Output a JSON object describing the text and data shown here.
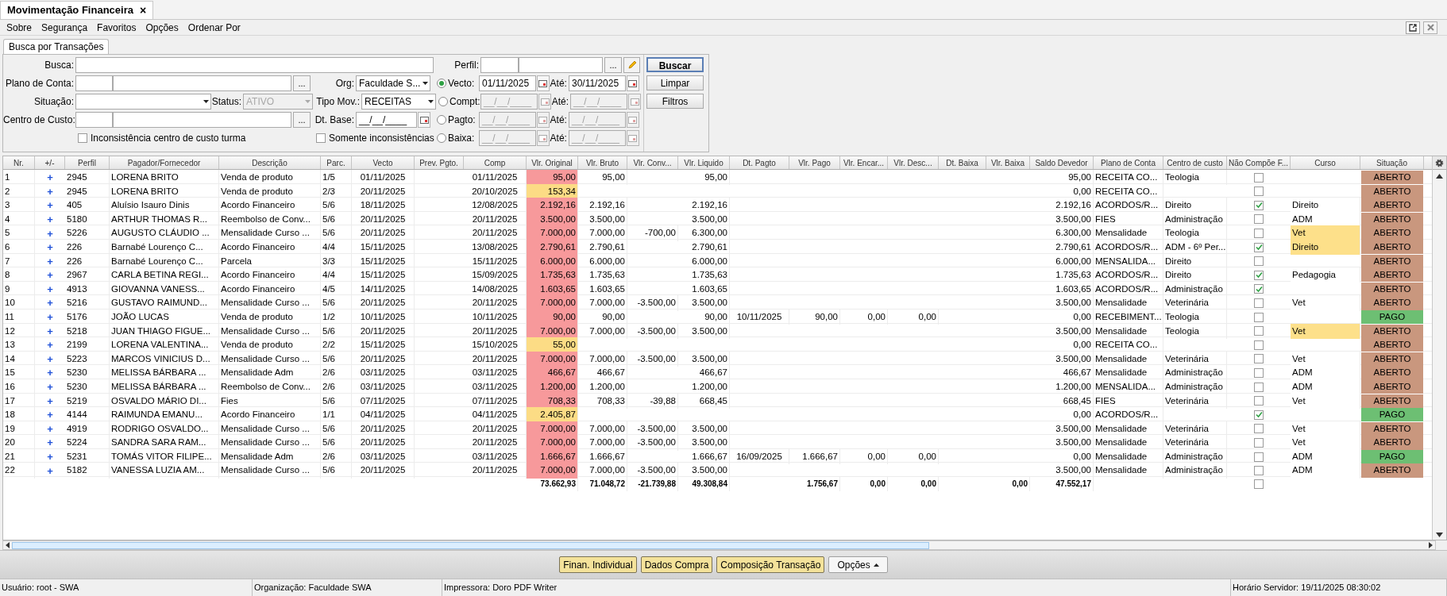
{
  "window": {
    "title": "Movimentação Financeira",
    "close": "×"
  },
  "menu": [
    "Sobre",
    "Segurança",
    "Favoritos",
    "Opções",
    "Ordenar Por"
  ],
  "search_form": {
    "tab": {
      "label": "Busca por Transações",
      "selected": true
    },
    "busca": {
      "label": "Busca:"
    },
    "perfil": {
      "label": "Perfil:",
      "button": "..."
    },
    "plano_de_conta": {
      "label": "Plano de Conta:",
      "button": "..."
    },
    "org": {
      "label": "Org:",
      "value": "Faculdade S..."
    },
    "situacao": {
      "label": "Situação:"
    },
    "status": {
      "label": "Status:",
      "value": "ATIVO",
      "disabled": true
    },
    "tipo_mov": {
      "label": "Tipo Mov.:",
      "value": "RECEITAS"
    },
    "centro_de_custo": {
      "label": "Centro de Custo:",
      "button": "..."
    },
    "dt_base": {
      "label": "Dt. Base:",
      "value": "__/__/____"
    },
    "checkboxes": [
      {
        "label": "Inconsistência centro de custo turma",
        "checked": false
      },
      {
        "label": "Somente inconsistências",
        "checked": false
      }
    ],
    "date_filters": [
      {
        "label": "Vecto:",
        "selected": true,
        "from": "01/11/2025",
        "to_label": "Até:",
        "to": "30/11/2025"
      },
      {
        "label": "Compt:",
        "selected": false,
        "from": "__/__/____",
        "to_label": "Até:",
        "to": "__/__/____"
      },
      {
        "label": "Pagto:",
        "selected": false,
        "from": "__/__/____",
        "to_label": "Até:",
        "to": "__/__/____"
      },
      {
        "label": "Baixa:",
        "selected": false,
        "from": "__/__/____",
        "to_label": "Até:",
        "to": "__/__/____"
      }
    ],
    "buttons": [
      {
        "label": "Buscar",
        "default": true
      },
      {
        "label": "Limpar",
        "default": false
      },
      {
        "label": "Filtros",
        "default": false
      }
    ]
  },
  "table": {
    "columns": [
      "Nr.",
      "+/-",
      "Perfil",
      "Pagador/Fornecedor",
      "Descrição",
      "Parc.",
      "Vecto",
      "Prev. Pgto.",
      "Comp",
      "Vlr. Original",
      "Vlr. Bruto",
      "Vlr. Conv...",
      "Vlr. Liquido",
      "Dt. Pagto",
      "Vlr. Pago",
      "Vlr. Encar...",
      "Vlr. Desc...",
      "Dt. Baixa",
      "Vlr. Baixa",
      "Saldo Devedor",
      "Plano de Conta",
      "Centro de custo",
      "Não Compõe F...",
      "Curso",
      "Situação"
    ],
    "rows": [
      {
        "nr": "1",
        "expand": "+",
        "perfil": "2945",
        "pagador": "LORENA BRITO",
        "descricao": "Venda de produto",
        "parc": "1/5",
        "vecto": "01/11/2025",
        "comp": "01/11/2025",
        "vlr_original": {
          "text": "95,00",
          "color": "#f7999b"
        },
        "vlr_bruto": "95,00",
        "vlr_liquido": "95,00",
        "saldo_devedor": "95,00",
        "plano_de_conta": "RECEITA CO...",
        "centro_de_custo": "Teologia",
        "nao_compoe": false,
        "situacao": {
          "text": "ABERTO",
          "color": "#c9977e"
        }
      },
      {
        "nr": "2",
        "expand": "+",
        "perfil": "2945",
        "pagador": "LORENA BRITO",
        "descricao": "Venda de produto",
        "parc": "2/3",
        "vecto": "20/11/2025",
        "comp": "20/10/2025",
        "vlr_original": {
          "text": "153,34",
          "color": "#fcdc85"
        },
        "saldo_devedor": "0,00",
        "plano_de_conta": "RECEITA CO...",
        "nao_compoe": false,
        "situacao": {
          "text": "ABERTO",
          "color": "#c9977e"
        }
      },
      {
        "nr": "3",
        "expand": "+",
        "perfil": "405",
        "pagador": "Aluísio Isauro Dinis",
        "descricao": "Acordo Financeiro",
        "parc": "5/6",
        "vecto": "18/11/2025",
        "comp": "12/08/2025",
        "vlr_original": {
          "text": "2.192,16",
          "color": "#f7999b"
        },
        "vlr_bruto": "2.192,16",
        "vlr_liquido": "2.192,16",
        "saldo_devedor": "2.192,16",
        "plano_de_conta": "ACORDOS/R...",
        "centro_de_custo": "Direito",
        "nao_compoe": true,
        "curso": {
          "text": "Direito",
          "highlighted": false
        },
        "situacao": {
          "text": "ABERTO",
          "color": "#c9977e"
        }
      },
      {
        "nr": "4",
        "expand": "+",
        "perfil": "5180",
        "pagador": "ARTHUR THOMAS R...",
        "descricao": "Reembolso de Conv...",
        "parc": "5/6",
        "vecto": "20/11/2025",
        "comp": "20/11/2025",
        "vlr_original": {
          "text": "3.500,00",
          "color": "#f7999b"
        },
        "vlr_bruto": "3.500,00",
        "vlr_liquido": "3.500,00",
        "saldo_devedor": "3.500,00",
        "plano_de_conta": "FIES",
        "centro_de_custo": "Administração",
        "nao_compoe": false,
        "curso": {
          "text": "ADM",
          "highlighted": false
        },
        "situacao": {
          "text": "ABERTO",
          "color": "#c9977e"
        }
      },
      {
        "nr": "5",
        "expand": "+",
        "perfil": "5226",
        "pagador": "AUGUSTO CLÁUDIO ...",
        "descricao": "Mensalidade Curso ...",
        "parc": "5/6",
        "vecto": "20/11/2025",
        "comp": "20/11/2025",
        "vlr_original": {
          "text": "7.000,00",
          "color": "#f7999b"
        },
        "vlr_bruto": "7.000,00",
        "vlr_conv": "-700,00",
        "vlr_liquido": "6.300,00",
        "saldo_devedor": "6.300,00",
        "plano_de_conta": "Mensalidade",
        "centro_de_custo": "Teologia",
        "nao_compoe": false,
        "curso": {
          "text": "Vet",
          "highlighted": true
        },
        "situacao": {
          "text": "ABERTO",
          "color": "#c9977e"
        }
      },
      {
        "nr": "6",
        "expand": "+",
        "perfil": "226",
        "pagador": "Barnabé Lourenço C...",
        "descricao": "Acordo Financeiro",
        "parc": "4/4",
        "vecto": "15/11/2025",
        "comp": "13/08/2025",
        "vlr_original": {
          "text": "2.790,61",
          "color": "#f7999b"
        },
        "vlr_bruto": "2.790,61",
        "vlr_liquido": "2.790,61",
        "saldo_devedor": "2.790,61",
        "plano_de_conta": "ACORDOS/R...",
        "centro_de_custo": "ADM - 6º Per...",
        "nao_compoe": true,
        "curso": {
          "text": "Direito",
          "highlighted": true
        },
        "situacao": {
          "text": "ABERTO",
          "color": "#c9977e"
        }
      },
      {
        "nr": "7",
        "expand": "+",
        "perfil": "226",
        "pagador": "Barnabé Lourenço C...",
        "descricao": "Parcela",
        "parc": "3/3",
        "vecto": "15/11/2025",
        "comp": "15/11/2025",
        "vlr_original": {
          "text": "6.000,00",
          "color": "#f7999b"
        },
        "vlr_bruto": "6.000,00",
        "vlr_liquido": "6.000,00",
        "saldo_devedor": "6.000,00",
        "plano_de_conta": "MENSALIDA...",
        "centro_de_custo": "Direito",
        "nao_compoe": false,
        "situacao": {
          "text": "ABERTO",
          "color": "#c9977e"
        }
      },
      {
        "nr": "8",
        "expand": "+",
        "perfil": "2967",
        "pagador": "CARLA BETINA REGI...",
        "descricao": "Acordo Financeiro",
        "parc": "4/4",
        "vecto": "15/11/2025",
        "comp": "15/09/2025",
        "vlr_original": {
          "text": "1.735,63",
          "color": "#f7999b"
        },
        "vlr_bruto": "1.735,63",
        "vlr_liquido": "1.735,63",
        "saldo_devedor": "1.735,63",
        "plano_de_conta": "ACORDOS/R...",
        "centro_de_custo": "Direito",
        "nao_compoe": true,
        "curso": {
          "text": "Pedagogia",
          "highlighted": false
        },
        "situacao": {
          "text": "ABERTO",
          "color": "#c9977e"
        }
      },
      {
        "nr": "9",
        "expand": "+",
        "perfil": "4913",
        "pagador": "GIOVANNA VANESS...",
        "descricao": "Acordo Financeiro",
        "parc": "4/5",
        "vecto": "14/11/2025",
        "comp": "14/08/2025",
        "vlr_original": {
          "text": "1.603,65",
          "color": "#f7999b"
        },
        "vlr_bruto": "1.603,65",
        "vlr_liquido": "1.603,65",
        "saldo_devedor": "1.603,65",
        "plano_de_conta": "ACORDOS/R...",
        "centro_de_custo": "Administração",
        "nao_compoe": true,
        "situacao": {
          "text": "ABERTO",
          "color": "#c9977e"
        }
      },
      {
        "nr": "10",
        "expand": "+",
        "perfil": "5216",
        "pagador": "GUSTAVO RAIMUND...",
        "descricao": "Mensalidade Curso ...",
        "parc": "5/6",
        "vecto": "20/11/2025",
        "comp": "20/11/2025",
        "vlr_original": {
          "text": "7.000,00",
          "color": "#f7999b"
        },
        "vlr_bruto": "7.000,00",
        "vlr_conv": "-3.500,00",
        "vlr_liquido": "3.500,00",
        "saldo_devedor": "3.500,00",
        "plano_de_conta": "Mensalidade",
        "centro_de_custo": "Veterinária",
        "nao_compoe": false,
        "curso": {
          "text": "Vet",
          "highlighted": false
        },
        "situacao": {
          "text": "ABERTO",
          "color": "#c9977e"
        }
      },
      {
        "nr": "11",
        "expand": "+",
        "perfil": "5176",
        "pagador": "JOÃO LUCAS",
        "descricao": "Venda de produto",
        "parc": "1/2",
        "vecto": "10/11/2025",
        "comp": "10/11/2025",
        "vlr_original": {
          "text": "90,00",
          "color": "#f7999b"
        },
        "vlr_bruto": "90,00",
        "vlr_liquido": "90,00",
        "dt_pagto": "10/11/2025",
        "vlr_pago": "90,00",
        "vlr_encar": "0,00",
        "vlr_desc": "0,00",
        "saldo_devedor": "0,00",
        "plano_de_conta": "RECEBIMENT...",
        "centro_de_custo": "Teologia",
        "nao_compoe": false,
        "situacao": {
          "text": "PAGO",
          "color": "#6dbf73"
        }
      },
      {
        "nr": "12",
        "expand": "+",
        "perfil": "5218",
        "pagador": "JUAN THIAGO FIGUE...",
        "descricao": "Mensalidade Curso ...",
        "parc": "5/6",
        "vecto": "20/11/2025",
        "comp": "20/11/2025",
        "vlr_original": {
          "text": "7.000,00",
          "color": "#f7999b"
        },
        "vlr_bruto": "7.000,00",
        "vlr_conv": "-3.500,00",
        "vlr_liquido": "3.500,00",
        "saldo_devedor": "3.500,00",
        "plano_de_conta": "Mensalidade",
        "centro_de_custo": "Teologia",
        "nao_compoe": false,
        "curso": {
          "text": "Vet",
          "highlighted": true
        },
        "situacao": {
          "text": "ABERTO",
          "color": "#c9977e"
        }
      },
      {
        "nr": "13",
        "expand": "+",
        "perfil": "2199",
        "pagador": "LORENA VALENTINA...",
        "descricao": "Venda de produto",
        "parc": "2/2",
        "vecto": "15/11/2025",
        "comp": "15/10/2025",
        "vlr_original": {
          "text": "55,00",
          "color": "#fcdc85"
        },
        "saldo_devedor": "0,00",
        "plano_de_conta": "RECEITA CO...",
        "nao_compoe": false,
        "situacao": {
          "text": "ABERTO",
          "color": "#c9977e"
        }
      },
      {
        "nr": "14",
        "expand": "+",
        "perfil": "5223",
        "pagador": "MARCOS VINICIUS D...",
        "descricao": "Mensalidade Curso ...",
        "parc": "5/6",
        "vecto": "20/11/2025",
        "comp": "20/11/2025",
        "vlr_original": {
          "text": "7.000,00",
          "color": "#f7999b"
        },
        "vlr_bruto": "7.000,00",
        "vlr_conv": "-3.500,00",
        "vlr_liquido": "3.500,00",
        "saldo_devedor": "3.500,00",
        "plano_de_conta": "Mensalidade",
        "centro_de_custo": "Veterinária",
        "nao_compoe": false,
        "curso": {
          "text": "Vet",
          "highlighted": false
        },
        "situacao": {
          "text": "ABERTO",
          "color": "#c9977e"
        }
      },
      {
        "nr": "15",
        "expand": "+",
        "perfil": "5230",
        "pagador": "MELISSA BÁRBARA ...",
        "descricao": "Mensalidade Adm",
        "parc": "2/6",
        "vecto": "03/11/2025",
        "comp": "03/11/2025",
        "vlr_original": {
          "text": "466,67",
          "color": "#f7999b"
        },
        "vlr_bruto": "466,67",
        "vlr_liquido": "466,67",
        "saldo_devedor": "466,67",
        "plano_de_conta": "Mensalidade",
        "centro_de_custo": "Administração",
        "nao_compoe": false,
        "curso": {
          "text": "ADM",
          "highlighted": false
        },
        "situacao": {
          "text": "ABERTO",
          "color": "#c9977e"
        }
      },
      {
        "nr": "16",
        "expand": "+",
        "perfil": "5230",
        "pagador": "MELISSA BÁRBARA ...",
        "descricao": "Reembolso de Conv...",
        "parc": "2/6",
        "vecto": "03/11/2025",
        "comp": "03/11/2025",
        "vlr_original": {
          "text": "1.200,00",
          "color": "#f7999b"
        },
        "vlr_bruto": "1.200,00",
        "vlr_liquido": "1.200,00",
        "saldo_devedor": "1.200,00",
        "plano_de_conta": "MENSALIDA...",
        "centro_de_custo": "Administração",
        "nao_compoe": false,
        "curso": {
          "text": "ADM",
          "highlighted": false
        },
        "situacao": {
          "text": "ABERTO",
          "color": "#c9977e"
        }
      },
      {
        "nr": "17",
        "expand": "+",
        "perfil": "5219",
        "pagador": "OSVALDO MÁRIO DI...",
        "descricao": "Fies",
        "parc": "5/6",
        "vecto": "07/11/2025",
        "comp": "07/11/2025",
        "vlr_original": {
          "text": "708,33",
          "color": "#f7999b"
        },
        "vlr_bruto": "708,33",
        "vlr_conv": "-39,88",
        "vlr_liquido": "668,45",
        "saldo_devedor": "668,45",
        "plano_de_conta": "FIES",
        "centro_de_custo": "Veterinária",
        "nao_compoe": false,
        "curso": {
          "text": "Vet",
          "highlighted": false
        },
        "situacao": {
          "text": "ABERTO",
          "color": "#c9977e"
        }
      },
      {
        "nr": "18",
        "expand": "+",
        "perfil": "4144",
        "pagador": "RAIMUNDA EMANU...",
        "descricao": "Acordo Financeiro",
        "parc": "1/1",
        "vecto": "04/11/2025",
        "comp": "04/11/2025",
        "vlr_original": {
          "text": "2.405,87",
          "color": "#fcdc85"
        },
        "saldo_devedor": "0,00",
        "plano_de_conta": "ACORDOS/R...",
        "nao_compoe": true,
        "situacao": {
          "text": "PAGO",
          "color": "#6dbf73"
        }
      },
      {
        "nr": "19",
        "expand": "+",
        "perfil": "4919",
        "pagador": "RODRIGO OSVALDO...",
        "descricao": "Mensalidade Curso ...",
        "parc": "5/6",
        "vecto": "20/11/2025",
        "comp": "20/11/2025",
        "vlr_original": {
          "text": "7.000,00",
          "color": "#f7999b"
        },
        "vlr_bruto": "7.000,00",
        "vlr_conv": "-3.500,00",
        "vlr_liquido": "3.500,00",
        "saldo_devedor": "3.500,00",
        "plano_de_conta": "Mensalidade",
        "centro_de_custo": "Veterinária",
        "nao_compoe": false,
        "curso": {
          "text": "Vet",
          "highlighted": false
        },
        "situacao": {
          "text": "ABERTO",
          "color": "#c9977e"
        }
      },
      {
        "nr": "20",
        "expand": "+",
        "perfil": "5224",
        "pagador": "SANDRA SARA RAM...",
        "descricao": "Mensalidade Curso ...",
        "parc": "5/6",
        "vecto": "20/11/2025",
        "comp": "20/11/2025",
        "vlr_original": {
          "text": "7.000,00",
          "color": "#f7999b"
        },
        "vlr_bruto": "7.000,00",
        "vlr_conv": "-3.500,00",
        "vlr_liquido": "3.500,00",
        "saldo_devedor": "3.500,00",
        "plano_de_conta": "Mensalidade",
        "centro_de_custo": "Veterinária",
        "nao_compoe": false,
        "curso": {
          "text": "Vet",
          "highlighted": false
        },
        "situacao": {
          "text": "ABERTO",
          "color": "#c9977e"
        }
      },
      {
        "nr": "21",
        "expand": "+",
        "perfil": "5231",
        "pagador": "TOMÁS VITOR FILIPE...",
        "descricao": "Mensalidade Adm",
        "parc": "2/6",
        "vecto": "03/11/2025",
        "comp": "03/11/2025",
        "vlr_original": {
          "text": "1.666,67",
          "color": "#f7999b"
        },
        "vlr_bruto": "1.666,67",
        "vlr_liquido": "1.666,67",
        "dt_pagto": "16/09/2025",
        "vlr_pago": "1.666,67",
        "vlr_encar": "0,00",
        "vlr_desc": "0,00",
        "saldo_devedor": "0,00",
        "plano_de_conta": "Mensalidade",
        "centro_de_custo": "Administração",
        "nao_compoe": false,
        "curso": {
          "text": "ADM",
          "highlighted": false
        },
        "situacao": {
          "text": "PAGO",
          "color": "#6dbf73"
        }
      },
      {
        "nr": "22",
        "expand": "+",
        "perfil": "5182",
        "pagador": "VANESSA LUZIA AM...",
        "descricao": "Mensalidade Curso ...",
        "parc": "5/6",
        "vecto": "20/11/2025",
        "comp": "20/11/2025",
        "vlr_original": {
          "text": "7.000,00",
          "color": "#f7999b"
        },
        "vlr_bruto": "7.000,00",
        "vlr_conv": "-3.500,00",
        "vlr_liquido": "3.500,00",
        "saldo_devedor": "3.500,00",
        "plano_de_conta": "Mensalidade",
        "centro_de_custo": "Administração",
        "nao_compoe": false,
        "curso": {
          "text": "ADM",
          "highlighted": false
        },
        "situacao": {
          "text": "ABERTO",
          "color": "#c9977e"
        }
      }
    ],
    "totals": {
      "vlr_original": "73.662,93",
      "vlr_bruto": "71.048,72",
      "vlr_conv": "-21.739,88",
      "vlr_liquido": "49.308,84",
      "vlr_pago": "1.756,67",
      "vlr_encar": "0,00",
      "vlr_desc": "0,00",
      "vlr_baixa": "0,00",
      "saldo_devedor": "47.552,17",
      "nao_compoe": false
    }
  },
  "action_buttons": [
    {
      "label": "Finan. Individual",
      "kind": "highlighted"
    },
    {
      "label": "Dados Compra",
      "kind": "highlighted"
    },
    {
      "label": "Composição Transação",
      "kind": "highlighted"
    },
    {
      "label": "Opções",
      "kind": "dropdown"
    }
  ],
  "status_bar": [
    "Usuário: root - SWA",
    "Organização: Faculdade SWA",
    "Impressora: Doro PDF Writer",
    "Horário Servidor: 19/11/2025 08:30:02"
  ]
}
